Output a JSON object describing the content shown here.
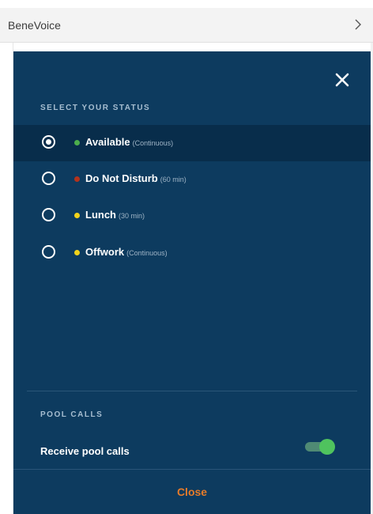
{
  "header": {
    "app_title": "BeneVoice"
  },
  "panel": {
    "status_section_label": "SELECT YOUR STATUS",
    "statuses": [
      {
        "label": "Available",
        "detail": "(Continuous)",
        "dot_color": "#4cae4c",
        "selected": true
      },
      {
        "label": "Do Not Disturb",
        "detail": "(60 min)",
        "dot_color": "#b2331d",
        "selected": false
      },
      {
        "label": "Lunch",
        "detail": "(30 min)",
        "dot_color": "#f2d31b",
        "selected": false
      },
      {
        "label": "Offwork",
        "detail": "(Continuous)",
        "dot_color": "#f2d31b",
        "selected": false
      }
    ],
    "pool_section_label": "POOL CALLS",
    "pool_toggle_label": "Receive pool calls",
    "pool_toggle_on": true,
    "close_label": "Close"
  },
  "colors": {
    "panel_bg": "#0d3b5f",
    "selected_row_bg": "#082d4b",
    "accent_close": "#e57b2a",
    "toggle_on": "#4fc35e"
  }
}
